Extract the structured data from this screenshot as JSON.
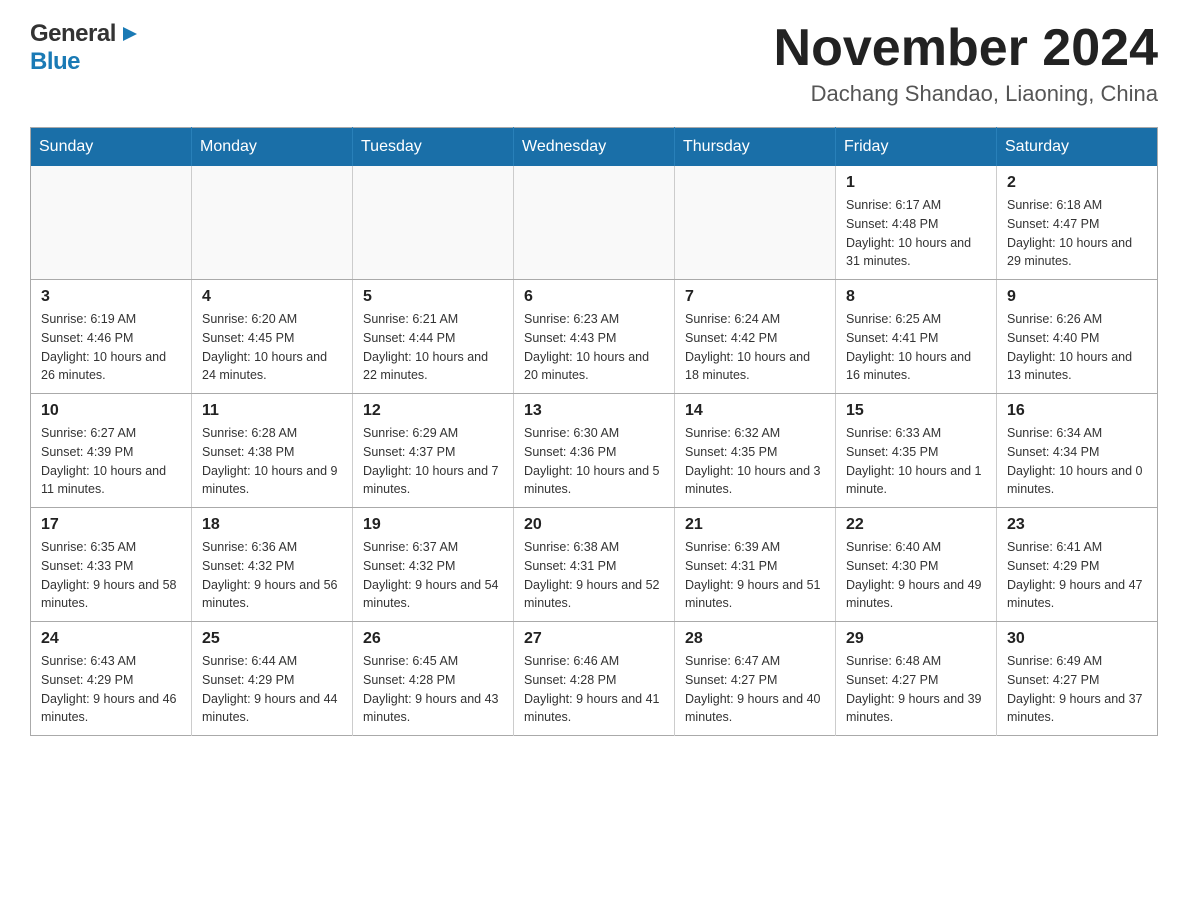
{
  "header": {
    "logo": {
      "general": "General",
      "blue": "Blue"
    },
    "title": "November 2024",
    "location": "Dachang Shandao, Liaoning, China"
  },
  "calendar": {
    "days": [
      "Sunday",
      "Monday",
      "Tuesday",
      "Wednesday",
      "Thursday",
      "Friday",
      "Saturday"
    ],
    "weeks": [
      [
        {
          "day": "",
          "info": ""
        },
        {
          "day": "",
          "info": ""
        },
        {
          "day": "",
          "info": ""
        },
        {
          "day": "",
          "info": ""
        },
        {
          "day": "",
          "info": ""
        },
        {
          "day": "1",
          "info": "Sunrise: 6:17 AM\nSunset: 4:48 PM\nDaylight: 10 hours\nand 31 minutes."
        },
        {
          "day": "2",
          "info": "Sunrise: 6:18 AM\nSunset: 4:47 PM\nDaylight: 10 hours\nand 29 minutes."
        }
      ],
      [
        {
          "day": "3",
          "info": "Sunrise: 6:19 AM\nSunset: 4:46 PM\nDaylight: 10 hours\nand 26 minutes."
        },
        {
          "day": "4",
          "info": "Sunrise: 6:20 AM\nSunset: 4:45 PM\nDaylight: 10 hours\nand 24 minutes."
        },
        {
          "day": "5",
          "info": "Sunrise: 6:21 AM\nSunset: 4:44 PM\nDaylight: 10 hours\nand 22 minutes."
        },
        {
          "day": "6",
          "info": "Sunrise: 6:23 AM\nSunset: 4:43 PM\nDaylight: 10 hours\nand 20 minutes."
        },
        {
          "day": "7",
          "info": "Sunrise: 6:24 AM\nSunset: 4:42 PM\nDaylight: 10 hours\nand 18 minutes."
        },
        {
          "day": "8",
          "info": "Sunrise: 6:25 AM\nSunset: 4:41 PM\nDaylight: 10 hours\nand 16 minutes."
        },
        {
          "day": "9",
          "info": "Sunrise: 6:26 AM\nSunset: 4:40 PM\nDaylight: 10 hours\nand 13 minutes."
        }
      ],
      [
        {
          "day": "10",
          "info": "Sunrise: 6:27 AM\nSunset: 4:39 PM\nDaylight: 10 hours\nand 11 minutes."
        },
        {
          "day": "11",
          "info": "Sunrise: 6:28 AM\nSunset: 4:38 PM\nDaylight: 10 hours\nand 9 minutes."
        },
        {
          "day": "12",
          "info": "Sunrise: 6:29 AM\nSunset: 4:37 PM\nDaylight: 10 hours\nand 7 minutes."
        },
        {
          "day": "13",
          "info": "Sunrise: 6:30 AM\nSunset: 4:36 PM\nDaylight: 10 hours\nand 5 minutes."
        },
        {
          "day": "14",
          "info": "Sunrise: 6:32 AM\nSunset: 4:35 PM\nDaylight: 10 hours\nand 3 minutes."
        },
        {
          "day": "15",
          "info": "Sunrise: 6:33 AM\nSunset: 4:35 PM\nDaylight: 10 hours\nand 1 minute."
        },
        {
          "day": "16",
          "info": "Sunrise: 6:34 AM\nSunset: 4:34 PM\nDaylight: 10 hours\nand 0 minutes."
        }
      ],
      [
        {
          "day": "17",
          "info": "Sunrise: 6:35 AM\nSunset: 4:33 PM\nDaylight: 9 hours\nand 58 minutes."
        },
        {
          "day": "18",
          "info": "Sunrise: 6:36 AM\nSunset: 4:32 PM\nDaylight: 9 hours\nand 56 minutes."
        },
        {
          "day": "19",
          "info": "Sunrise: 6:37 AM\nSunset: 4:32 PM\nDaylight: 9 hours\nand 54 minutes."
        },
        {
          "day": "20",
          "info": "Sunrise: 6:38 AM\nSunset: 4:31 PM\nDaylight: 9 hours\nand 52 minutes."
        },
        {
          "day": "21",
          "info": "Sunrise: 6:39 AM\nSunset: 4:31 PM\nDaylight: 9 hours\nand 51 minutes."
        },
        {
          "day": "22",
          "info": "Sunrise: 6:40 AM\nSunset: 4:30 PM\nDaylight: 9 hours\nand 49 minutes."
        },
        {
          "day": "23",
          "info": "Sunrise: 6:41 AM\nSunset: 4:29 PM\nDaylight: 9 hours\nand 47 minutes."
        }
      ],
      [
        {
          "day": "24",
          "info": "Sunrise: 6:43 AM\nSunset: 4:29 PM\nDaylight: 9 hours\nand 46 minutes."
        },
        {
          "day": "25",
          "info": "Sunrise: 6:44 AM\nSunset: 4:29 PM\nDaylight: 9 hours\nand 44 minutes."
        },
        {
          "day": "26",
          "info": "Sunrise: 6:45 AM\nSunset: 4:28 PM\nDaylight: 9 hours\nand 43 minutes."
        },
        {
          "day": "27",
          "info": "Sunrise: 6:46 AM\nSunset: 4:28 PM\nDaylight: 9 hours\nand 41 minutes."
        },
        {
          "day": "28",
          "info": "Sunrise: 6:47 AM\nSunset: 4:27 PM\nDaylight: 9 hours\nand 40 minutes."
        },
        {
          "day": "29",
          "info": "Sunrise: 6:48 AM\nSunset: 4:27 PM\nDaylight: 9 hours\nand 39 minutes."
        },
        {
          "day": "30",
          "info": "Sunrise: 6:49 AM\nSunset: 4:27 PM\nDaylight: 9 hours\nand 37 minutes."
        }
      ]
    ]
  }
}
